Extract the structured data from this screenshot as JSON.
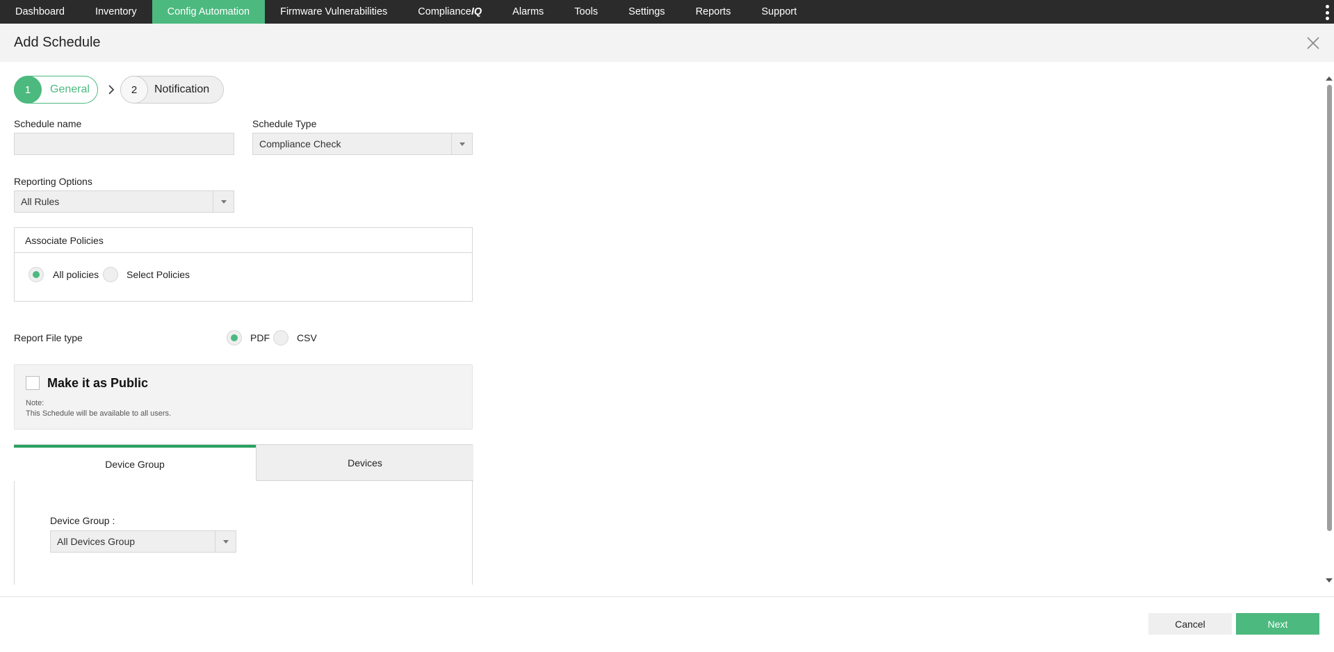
{
  "nav": {
    "items": [
      {
        "label": "Dashboard"
      },
      {
        "label": "Inventory"
      },
      {
        "label": "Config Automation"
      },
      {
        "label": "Firmware Vulnerabilities"
      },
      {
        "label_prefix": "Compliance",
        "label_suffix": "IQ"
      },
      {
        "label": "Alarms"
      },
      {
        "label": "Tools"
      },
      {
        "label": "Settings"
      },
      {
        "label": "Reports"
      },
      {
        "label": "Support"
      }
    ],
    "active": "Config Automation"
  },
  "header": {
    "title": "Add Schedule"
  },
  "steps": [
    {
      "number": "1",
      "label": "General",
      "state": "active"
    },
    {
      "number": "2",
      "label": "Notification",
      "state": "inactive"
    }
  ],
  "form": {
    "schedule_name": {
      "label": "Schedule name",
      "value": ""
    },
    "schedule_type": {
      "label": "Schedule Type",
      "value": "Compliance Check"
    },
    "reporting_options": {
      "label": "Reporting Options",
      "value": "All Rules"
    },
    "associate_policies": {
      "title": "Associate Policies",
      "options": [
        {
          "label": "All policies",
          "selected": true
        },
        {
          "label": "Select Policies",
          "selected": false
        }
      ]
    },
    "report_file_type": {
      "label": "Report File type",
      "options": [
        {
          "label": "PDF",
          "selected": true
        },
        {
          "label": "CSV",
          "selected": false
        }
      ]
    },
    "make_public": {
      "label": "Make it as Public",
      "checked": false,
      "note_title": "Note:",
      "note_text": "This Schedule will be available to all users."
    },
    "device_tabs": {
      "tabs": [
        {
          "label": "Device Group",
          "active": true
        },
        {
          "label": "Devices",
          "active": false
        }
      ],
      "device_group": {
        "label": "Device Group :",
        "value": "All Devices Group"
      }
    }
  },
  "footer": {
    "cancel_label": "Cancel",
    "next_label": "Next"
  },
  "colors": {
    "accent": "#4cb97f",
    "nav_bg": "#2b2b2b",
    "tab_active_border": "#2aa060"
  },
  "icons": {
    "close": "close-icon",
    "step_arrow": "chevron-right-icon",
    "kebab": "more-vertical-icon",
    "dropdown": "caret-down-icon"
  }
}
